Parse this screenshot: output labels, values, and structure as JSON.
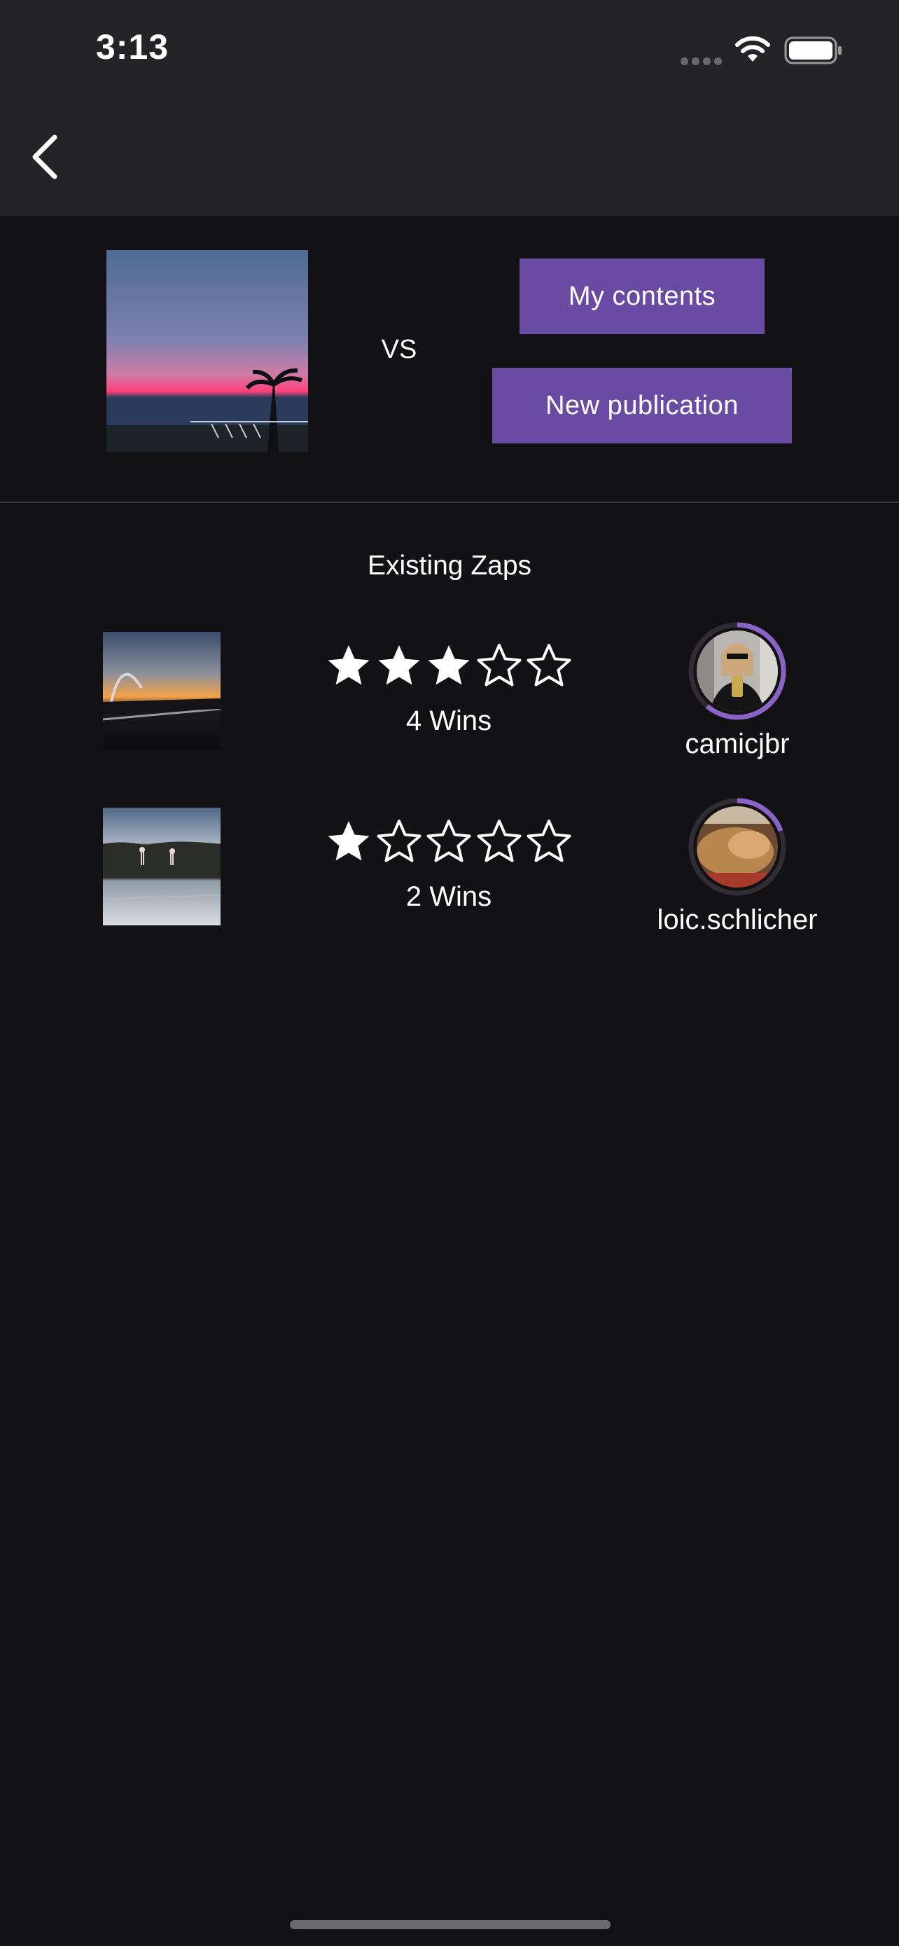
{
  "status_bar": {
    "time": "3:13"
  },
  "compare": {
    "vs_label": "VS",
    "my_contents_label": "My contents",
    "new_publication_label": "New publication"
  },
  "existing_zaps": {
    "title": "Existing Zaps",
    "rows": [
      {
        "rating": 3,
        "rating_max": 5,
        "wins_label": "4 Wins",
        "username": "camicjbr"
      },
      {
        "rating": 1,
        "rating_max": 5,
        "wins_label": "2 Wins",
        "username": "loic.schlicher"
      }
    ]
  },
  "colors": {
    "background": "#121113",
    "header": "#242325",
    "accent": "#6a4ba3",
    "ring": "#8a63c6"
  },
  "icons": {
    "back": "chevron-left-icon",
    "wifi": "wifi-icon",
    "battery": "battery-icon",
    "star_filled": "star-filled-icon",
    "star_outline": "star-outline-icon"
  }
}
